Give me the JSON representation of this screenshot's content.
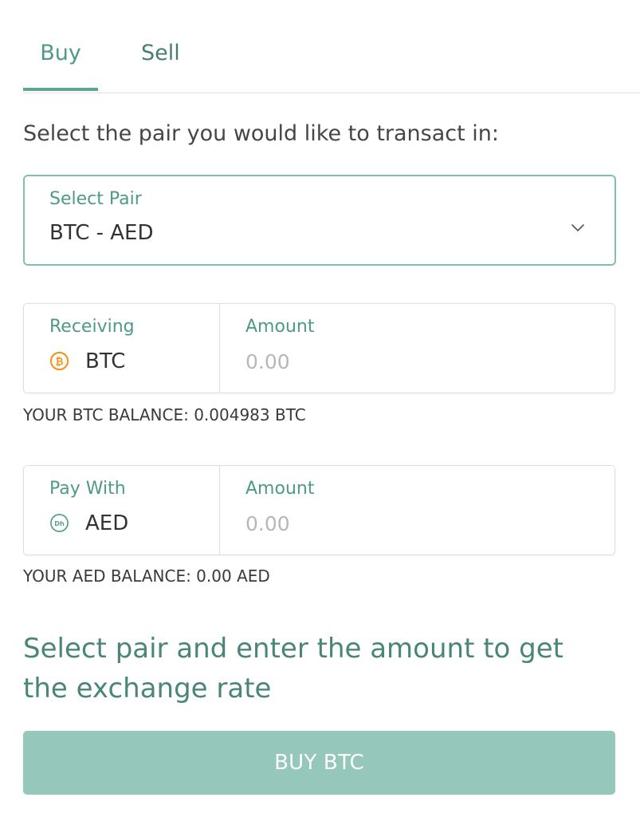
{
  "tabs": {
    "buy": "Buy",
    "sell": "Sell",
    "active": "Buy"
  },
  "instruction": "Select the pair you would like to transact in:",
  "pair_select": {
    "label": "Select Pair",
    "value": "BTC - AED",
    "icon": "chevron-down-icon"
  },
  "receiving": {
    "label": "Receiving",
    "currency": "BTC",
    "icon": "bitcoin-icon",
    "icon_color": "#f7931a",
    "amount_label": "Amount",
    "amount_placeholder": "0.00",
    "amount_value": "",
    "balance": "YOUR BTC BALANCE: 0.004983 BTC"
  },
  "pay_with": {
    "label": "Pay With",
    "currency": "AED",
    "icon": "dirham-icon",
    "icon_color": "#56a18f",
    "amount_label": "Amount",
    "amount_placeholder": "0.00",
    "amount_value": "",
    "balance": "YOUR AED BALANCE: 0.00 AED"
  },
  "rate_message": "Select pair and enter the amount to get the exchange rate",
  "buy_button": "BUY BTC",
  "colors": {
    "accent": "#4e9a88",
    "button_bg": "#96c7bb",
    "border_active": "#82bfae"
  }
}
